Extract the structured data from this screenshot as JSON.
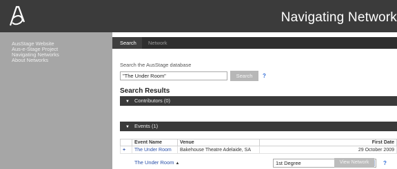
{
  "header": {
    "title": "Navigating Network"
  },
  "sidebar": {
    "links": [
      "AusStage Website",
      "Aus-e-Stage Project",
      "Navigating Networks",
      "About Networks"
    ]
  },
  "tabs": [
    "Search",
    "Network"
  ],
  "search": {
    "prompt": "Search the AusStage database",
    "value": "\"The Under Room\"",
    "button": "Search",
    "help": "?"
  },
  "results": {
    "heading": "Search Results",
    "contributors_label": "Contributors (0)",
    "events_label": "Events (1)",
    "table": {
      "headers": [
        "Event Name",
        "Venue",
        "First Date"
      ],
      "rows": [
        {
          "add": "+",
          "name": "The Under Room",
          "venue": "Bakehouse Theatre Adelaide, SA",
          "date": "29 October 2009"
        }
      ]
    },
    "selected": {
      "event": "The Under Room",
      "mark": "▲",
      "degree": "1st Degree",
      "view_button": "View Network",
      "help": "?"
    }
  }
}
